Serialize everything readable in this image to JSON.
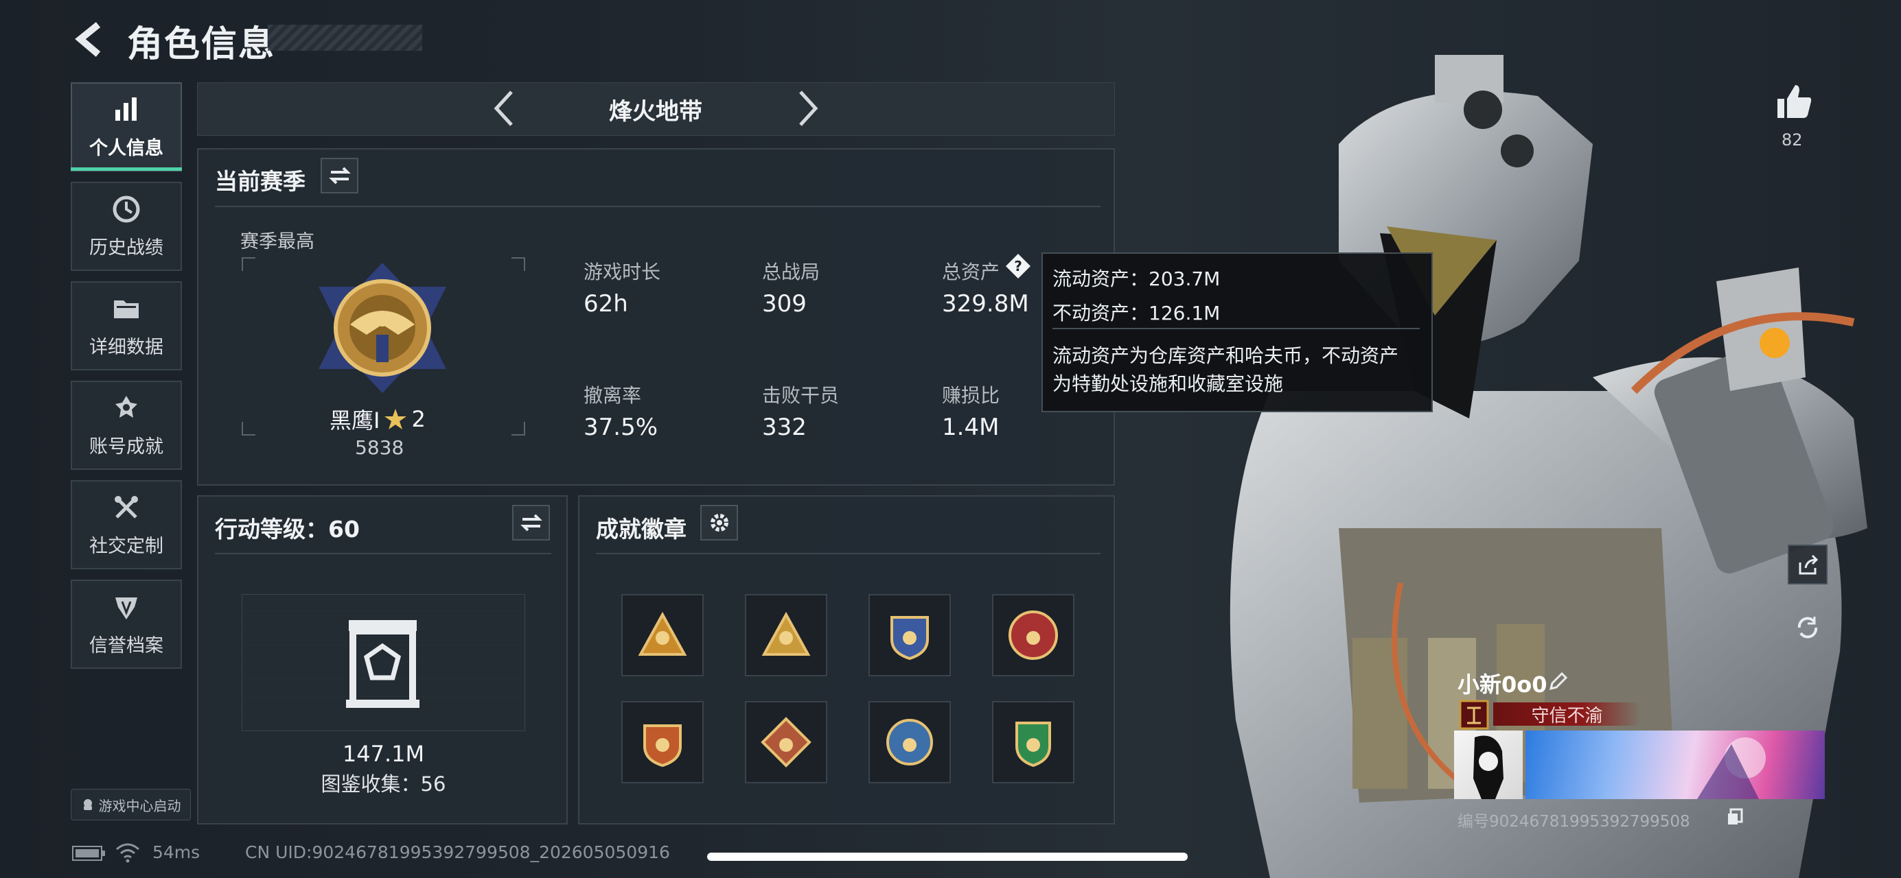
{
  "header": {
    "title": "角色信息"
  },
  "sidebar": {
    "items": [
      {
        "label": "个人信息",
        "icon": "bar-chart-icon",
        "active": true
      },
      {
        "label": "历史战绩",
        "icon": "clock-icon"
      },
      {
        "label": "详细数据",
        "icon": "folder-icon"
      },
      {
        "label": "账号成就",
        "icon": "medal-icon"
      },
      {
        "label": "社交定制",
        "icon": "tools-icon"
      },
      {
        "label": "信誉档案",
        "icon": "shield-icon"
      }
    ],
    "game_center": "游戏中心启动"
  },
  "mode": {
    "name": "烽火地带"
  },
  "season": {
    "title": "当前赛季",
    "best_label": "赛季最高",
    "rank_name": "黑鹰I",
    "rank_stars": "2",
    "rank_score": "5838",
    "stats": [
      {
        "label": "游戏时长",
        "value": "62h"
      },
      {
        "label": "总战局",
        "value": "309"
      },
      {
        "label": "总资产",
        "value": "329.8M"
      },
      {
        "label": "撤离率",
        "value": "37.5%"
      },
      {
        "label": "击败干员",
        "value": "332"
      },
      {
        "label": "赚损比",
        "value": "1.4M"
      }
    ]
  },
  "tooltip": {
    "line1": "流动资产：203.7M",
    "line2": "不动资产：126.1M",
    "desc1": "流动资产为仓库资产和哈夫币，不动资产",
    "desc2": "为特勤处设施和收藏室设施"
  },
  "action": {
    "title": "行动等级：60",
    "value": "147.1M",
    "collection": "图鉴收集：56"
  },
  "achievements": {
    "title": "成就徽章",
    "badges": [
      {
        "icon": "triangle-gold-badge",
        "color": "#c98b2a"
      },
      {
        "icon": "triangle-gear-badge",
        "color": "#c99a3a"
      },
      {
        "icon": "shield-anchor-badge",
        "color": "#3b5aa0"
      },
      {
        "icon": "round-star-badge",
        "color": "#a83232"
      },
      {
        "icon": "winged-shield-badge",
        "color": "#c05a2a"
      },
      {
        "icon": "dragon-diamond-badge",
        "color": "#b0573a"
      },
      {
        "icon": "eagle-round-badge",
        "color": "#3d6fa8"
      },
      {
        "icon": "green-shield-badge",
        "color": "#2f8a4d"
      }
    ]
  },
  "player": {
    "likes": "82",
    "name": "小新0o0",
    "title_tag": "守信不渝",
    "card_id": "编号9024678199539279950​8"
  },
  "status": {
    "ping": "54ms",
    "uid": "CN UID:9024678199539279950​8_202605050916"
  },
  "colors": {
    "accent": "#4fd1a8",
    "panel": "#232b33",
    "tag_red": "#8c1818"
  }
}
